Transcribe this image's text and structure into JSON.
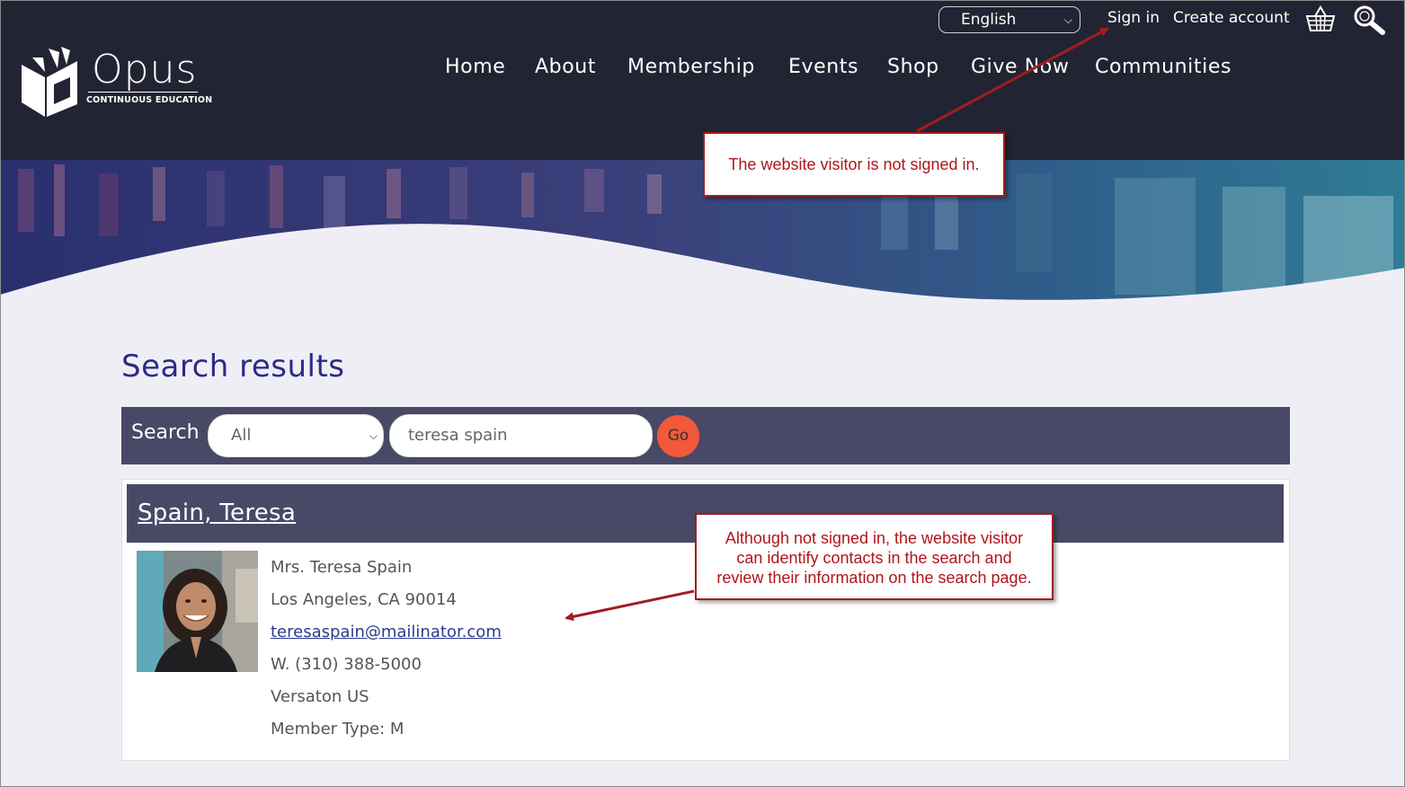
{
  "header": {
    "logo": {
      "word": "Opus",
      "tagline": "CONTINUOUS  EDUCATION"
    },
    "language": "English",
    "sign_in": "Sign in",
    "create_account": "Create account",
    "icons": {
      "cart": "shopping-basket-icon",
      "search": "magnifier-icon"
    }
  },
  "nav": {
    "items": [
      {
        "label": "Home"
      },
      {
        "label": "About"
      },
      {
        "label": "Membership"
      },
      {
        "label": "Events"
      },
      {
        "label": "Shop"
      },
      {
        "label": "Give Now"
      },
      {
        "label": "Communities"
      }
    ]
  },
  "main": {
    "title": "Search results",
    "search": {
      "label": "Search",
      "type_value": "All",
      "query": "teresa spain",
      "go_label": "Go"
    },
    "result": {
      "name": "Spain, Teresa",
      "full_name": "Mrs. Teresa Spain",
      "location": "Los Angeles, CA 90014",
      "email": "teresaspain@mailinator.com",
      "phone": "W. (310) 388-5000",
      "organization": "Versaton US",
      "member_type": "Member Type: M"
    }
  },
  "annotations": {
    "signed_out_note": "The website visitor is not signed in.",
    "result_note_lines": [
      "Although not signed in, the website visitor",
      "can identify contacts in the search and",
      "review their information on the search page."
    ]
  },
  "colors": {
    "header_bg": "#232433",
    "bar_bg": "#474966",
    "title": "#2b2b8a",
    "go_button": "#f2583a",
    "callout": "#a31c20",
    "page_bg": "#f0eef5"
  }
}
